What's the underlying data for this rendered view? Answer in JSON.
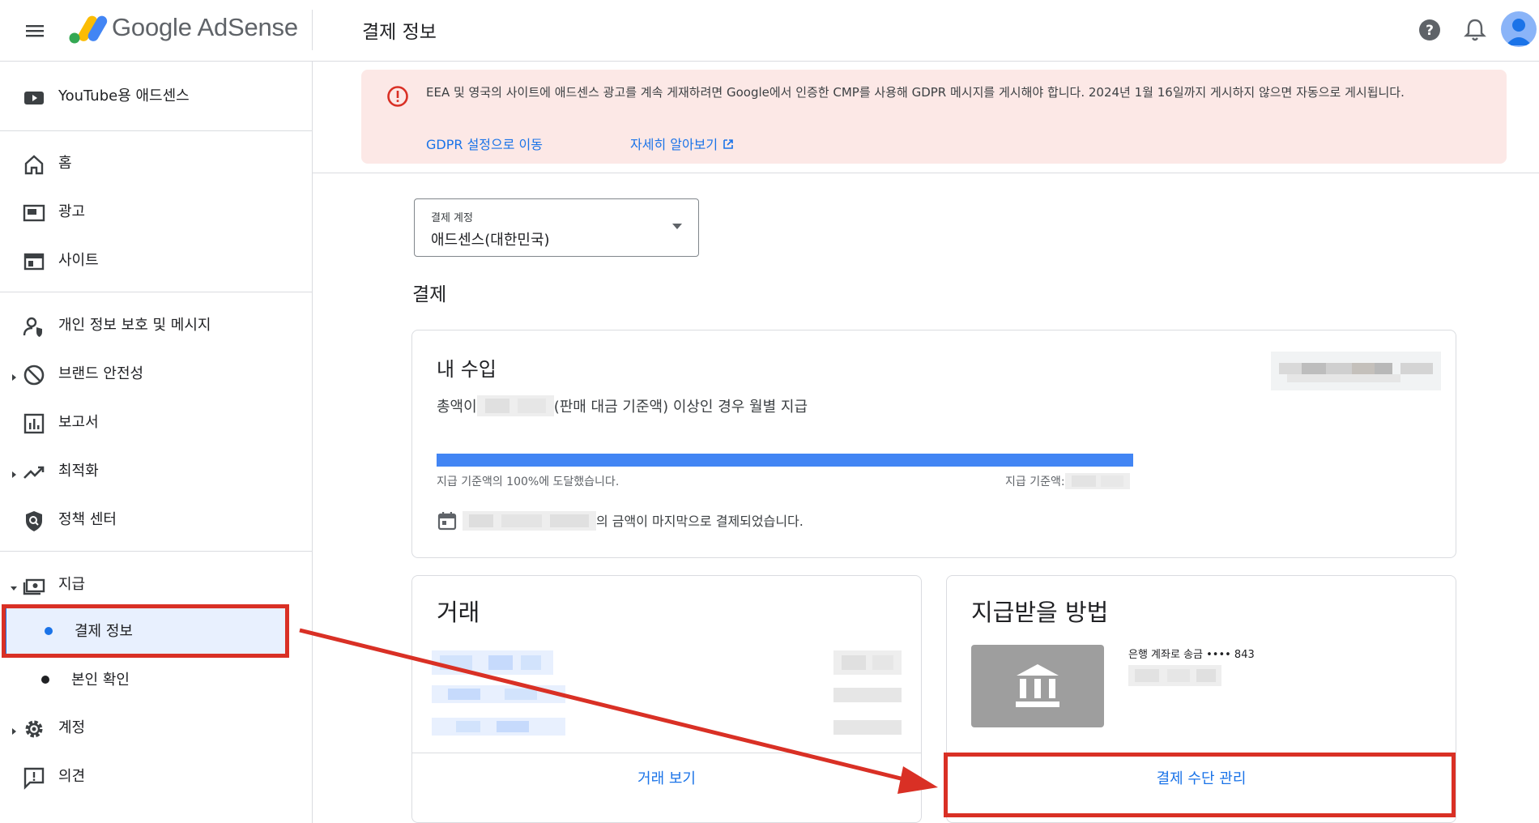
{
  "header": {
    "brand": "Google AdSense",
    "title": "결제 정보"
  },
  "sidebar": {
    "youtube": "YouTube용 애드센스",
    "items": [
      {
        "label": "홈"
      },
      {
        "label": "광고"
      },
      {
        "label": "사이트"
      },
      {
        "label": "개인 정보 보호 및 메시지"
      },
      {
        "label": "브랜드 안전성"
      },
      {
        "label": "보고서"
      },
      {
        "label": "최적화"
      },
      {
        "label": "정책 센터"
      },
      {
        "label": "지급"
      },
      {
        "label": "결제 정보"
      },
      {
        "label": "본인 확인"
      },
      {
        "label": "계정"
      },
      {
        "label": "의견"
      }
    ]
  },
  "alert": {
    "text": "EEA 및 영국의 사이트에 애드센스 광고를 계속 게재하려면 Google에서 인증한 CMP를 사용해 GDPR 메시지를 게시해야 합니다. 2024년 1월 16일까지 게시하지 않으면 자동으로 게시됩니다.",
    "link_gdpr": "GDPR 설정으로 이동",
    "link_learn": "자세히 알아보기"
  },
  "account_select": {
    "label": "결제 계정",
    "value": "애드센스(대한민국)"
  },
  "section_title": "결제",
  "earnings": {
    "title": "내 수입",
    "desc_prefix": "총액이",
    "desc_suffix": "(판매 대금 기준액) 이상인 경우 월별 지급",
    "progress_fraction": 1.0,
    "progress_left": "지급 기준액의 100%에 도달했습니다.",
    "progress_right": "지급 기준액:",
    "last_payment_suffix": "의 금액이 마지막으로 결제되었습니다."
  },
  "transactions": {
    "title": "거래",
    "link": "거래 보기"
  },
  "payment_method": {
    "title": "지급받을 방법",
    "bank_text": "은행 계좌로 송금 •••• 843",
    "link": "결제 수단 관리"
  },
  "colors": {
    "accent": "#1a73e8",
    "progress": "#4285f4",
    "alert_bg": "#fce8e6",
    "alert_icon": "#d93025",
    "highlight": "#d93025"
  }
}
